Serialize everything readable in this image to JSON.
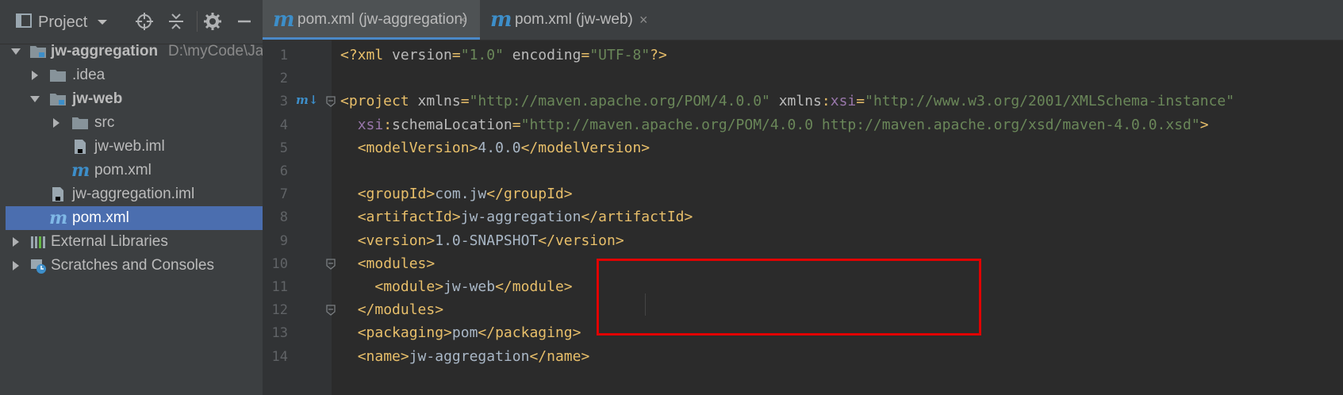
{
  "project_panel": {
    "title": "Project",
    "buttons": [
      "locate-icon",
      "collapse-icon",
      "gear-icon",
      "hide-icon"
    ],
    "tree": [
      {
        "label": "jw-aggregation",
        "path": "D:\\myCode\\Ja",
        "icon": "module-folder-icon",
        "expanded": true,
        "bold": true
      },
      {
        "label": ".idea",
        "icon": "folder-icon",
        "expanded": false
      },
      {
        "label": "jw-web",
        "icon": "module-folder-icon",
        "expanded": true,
        "bold": true
      },
      {
        "label": "src",
        "icon": "folder-icon",
        "expanded": false
      },
      {
        "label": "jw-web.iml",
        "icon": "iml-file-icon"
      },
      {
        "label": "pom.xml",
        "icon": "maven-file-icon"
      },
      {
        "label": "jw-aggregation.iml",
        "icon": "iml-file-icon"
      },
      {
        "label": "pom.xml",
        "icon": "maven-file-icon",
        "selected": true
      },
      {
        "label": "External Libraries",
        "icon": "library-icon",
        "expanded": false
      },
      {
        "label": "Scratches and Consoles",
        "icon": "scratches-icon",
        "expanded": false
      }
    ]
  },
  "editor": {
    "tabs": [
      {
        "label": "pom.xml (jw-aggregation)",
        "close": "×",
        "active": true
      },
      {
        "label": "pom.xml (jw-web)",
        "close": "×",
        "active": false
      }
    ],
    "gutter_marker": "m↓",
    "line_numbers": [
      "1",
      "2",
      "3",
      "4",
      "5",
      "6",
      "7",
      "8",
      "9",
      "10",
      "11",
      "12",
      "13",
      "14"
    ],
    "lines": [
      [
        {
          "t": "tag",
          "v": "<?xml "
        },
        {
          "t": "attr",
          "v": "version"
        },
        {
          "t": "tag",
          "v": "="
        },
        {
          "t": "val",
          "v": "\"1.0\""
        },
        {
          "t": "attr",
          "v": " encoding"
        },
        {
          "t": "tag",
          "v": "="
        },
        {
          "t": "val",
          "v": "\"UTF-8\""
        },
        {
          "t": "tag",
          "v": "?>"
        }
      ],
      [],
      [
        {
          "t": "tag",
          "v": "<project "
        },
        {
          "t": "attr",
          "v": "xmlns"
        },
        {
          "t": "tag",
          "v": "="
        },
        {
          "t": "val",
          "v": "\"http://maven.apache.org/POM/4.0.0\""
        },
        {
          "t": "attr",
          "v": " xmlns"
        },
        {
          "t": "tag",
          "v": ":"
        },
        {
          "t": "ns",
          "v": "xsi"
        },
        {
          "t": "tag",
          "v": "="
        },
        {
          "t": "val",
          "v": "\"http://www.w3.org/2001/XMLSchema-instance\""
        }
      ],
      [
        {
          "t": "txt",
          "v": "  "
        },
        {
          "t": "ns",
          "v": "xsi"
        },
        {
          "t": "tag",
          "v": ":"
        },
        {
          "t": "attr",
          "v": "schemaLocation"
        },
        {
          "t": "tag",
          "v": "="
        },
        {
          "t": "val",
          "v": "\"http://maven.apache.org/POM/4.0.0 http://maven.apache.org/xsd/maven-4.0.0.xsd\""
        },
        {
          "t": "tag",
          "v": ">"
        }
      ],
      [
        {
          "t": "txt",
          "v": "  "
        },
        {
          "t": "tag",
          "v": "<modelVersion>"
        },
        {
          "t": "txt",
          "v": "4.0.0"
        },
        {
          "t": "tag",
          "v": "</modelVersion>"
        }
      ],
      [],
      [
        {
          "t": "txt",
          "v": "  "
        },
        {
          "t": "tag",
          "v": "<groupId>"
        },
        {
          "t": "txt",
          "v": "com.jw"
        },
        {
          "t": "tag",
          "v": "</groupId>"
        }
      ],
      [
        {
          "t": "txt",
          "v": "  "
        },
        {
          "t": "tag",
          "v": "<artifactId>"
        },
        {
          "t": "txt",
          "v": "jw-aggregation"
        },
        {
          "t": "tag",
          "v": "</artifactId>"
        }
      ],
      [
        {
          "t": "txt",
          "v": "  "
        },
        {
          "t": "tag",
          "v": "<version>"
        },
        {
          "t": "txt",
          "v": "1.0-SNAPSHOT"
        },
        {
          "t": "tag",
          "v": "</version>"
        }
      ],
      [
        {
          "t": "txt",
          "v": "  "
        },
        {
          "t": "tag",
          "v": "<modules>"
        }
      ],
      [
        {
          "t": "txt",
          "v": "    "
        },
        {
          "t": "tag",
          "v": "<module>"
        },
        {
          "t": "txt",
          "v": "jw-web"
        },
        {
          "t": "tag",
          "v": "</module>"
        }
      ],
      [
        {
          "t": "txt",
          "v": "  "
        },
        {
          "t": "tag",
          "v": "</modules>"
        }
      ],
      [
        {
          "t": "txt",
          "v": "  "
        },
        {
          "t": "tag",
          "v": "<packaging>"
        },
        {
          "t": "txt",
          "v": "pom"
        },
        {
          "t": "tag",
          "v": "</packaging>"
        }
      ],
      [
        {
          "t": "txt",
          "v": "  "
        },
        {
          "t": "tag",
          "v": "<name>"
        },
        {
          "t": "txt",
          "v": "jw-aggregation"
        },
        {
          "t": "tag",
          "v": "</name>"
        }
      ]
    ],
    "fold_lines": [
      3,
      10,
      12
    ],
    "highlight": {
      "lines": [
        10,
        12
      ],
      "color": "#e10000"
    }
  },
  "colors": {
    "tag": "#e8bf6a",
    "attr": "#bababa",
    "value": "#6a8759",
    "namespace": "#9876aa",
    "text": "#a9b7c6",
    "selection": "#4b6eaf",
    "maven": "#3d8ec9"
  }
}
